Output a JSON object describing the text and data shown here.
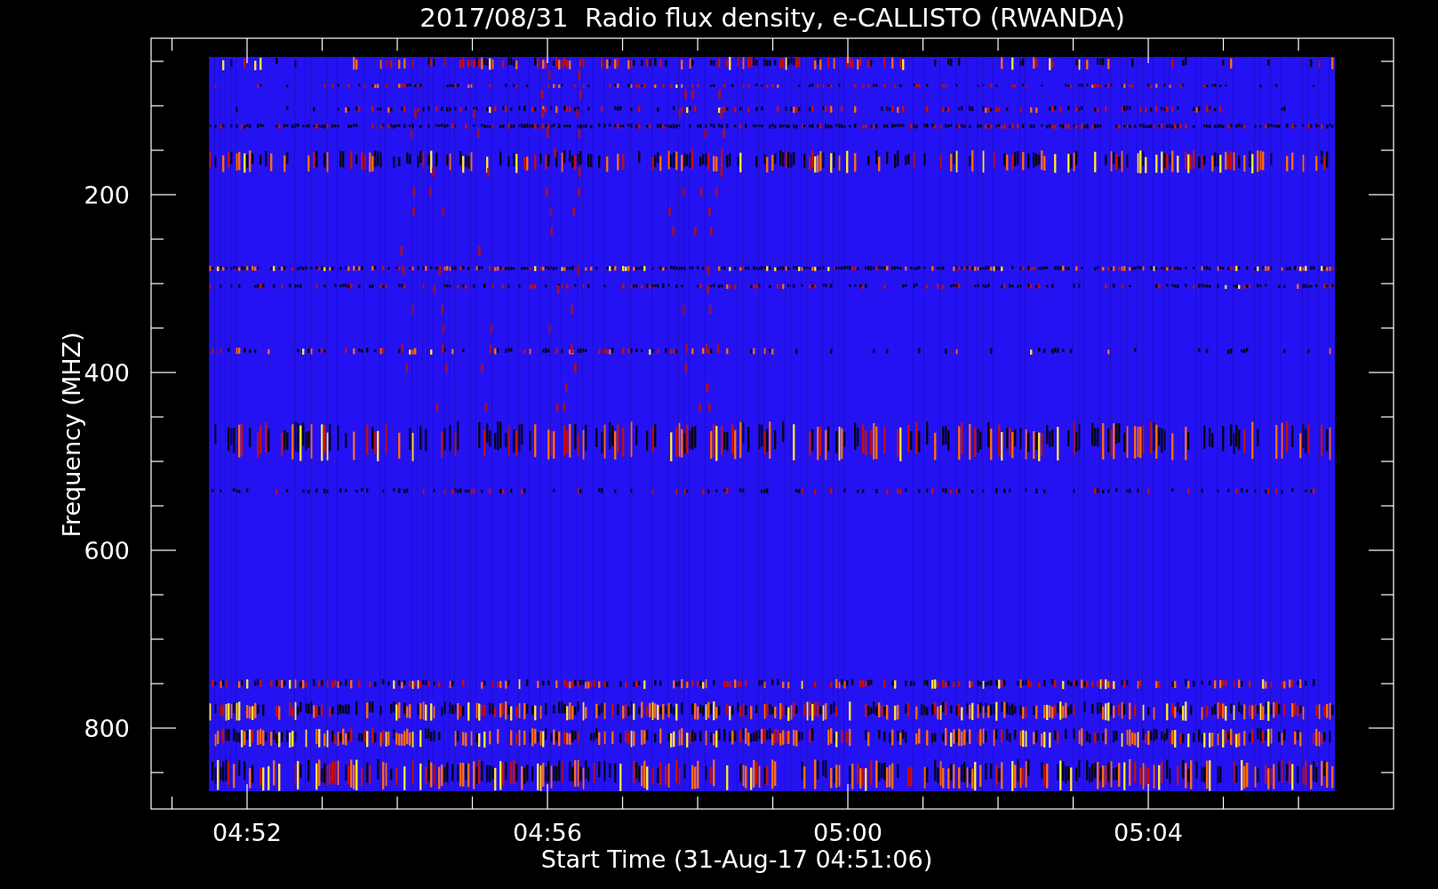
{
  "title": "2017/08/31  Radio flux density, e-CALLISTO (RWANDA)",
  "plot": {
    "ylabel": "Frequency (MHZ)",
    "xlabel": "Start Time (31-Aug-17 04:51:06)",
    "yticks": [
      "200",
      "400",
      "600",
      "800"
    ],
    "xticks": [
      "04:52",
      "04:56",
      "05:00",
      "05:04"
    ]
  }
}
